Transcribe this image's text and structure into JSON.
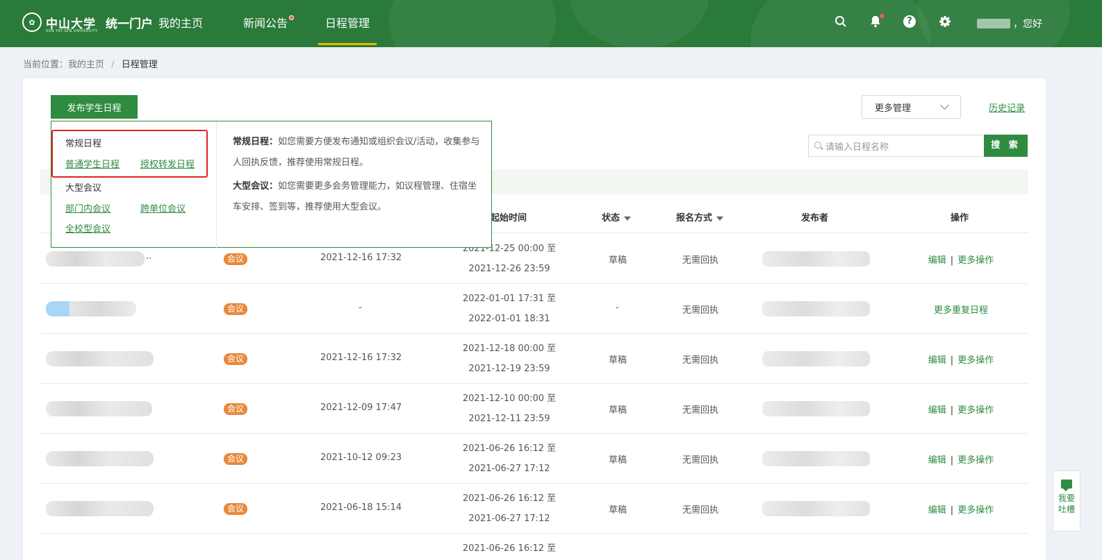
{
  "header": {
    "logo_school": "中山大学",
    "logo_sub": "SUN YAT-SEN UNIVERSITY",
    "portal": "统一门户",
    "nav": [
      {
        "label": "我的主页"
      },
      {
        "label": "新闻公告"
      },
      {
        "label": "日程管理"
      }
    ],
    "greeting": "，您好",
    "colors": {
      "brand": "#2a7a3a",
      "accent": "#f0b400",
      "badge": "#ff5b5b"
    },
    "icons": [
      "search-icon",
      "bell-icon",
      "help-icon",
      "gear-icon"
    ]
  },
  "breadcrumb": {
    "prefix": "当前位置：我的主页",
    "separator": "/",
    "current": "日程管理"
  },
  "toolbar": {
    "publish_label": "发布学生日程",
    "more_manage_label": "更多管理",
    "history_label": "历史记录",
    "search_placeholder": "请输入日程名称",
    "search_button": "搜 索"
  },
  "popup": {
    "group1_title": "常规日程",
    "group1_links": [
      "普通学生日程",
      "授权转发日程"
    ],
    "group2_title": "大型会议",
    "group2_links": [
      "部门内会议",
      "跨单位会议",
      "全校型会议"
    ],
    "desc1_title": "常规日程：",
    "desc1_text": "如您需要方便发布通知或组织会议/活动，收集参与人回执反馈，推荐使用常规日程。",
    "desc2_title": "大型会议：",
    "desc2_text": "如您需要更多会务管理能力，如议程管理、住宿坐车安排、签到等，推荐使用大型会议。"
  },
  "table": {
    "headers": {
      "start_time": "起始时间",
      "status": "状态",
      "signup": "报名方式",
      "publisher": "发布者",
      "actions": "操作"
    },
    "rows": [
      {
        "tag": "会议",
        "created": "2021-12-16 17:32",
        "start": "2021-12-25 00:00 至",
        "end": "2021-12-26 23:59",
        "status": "草稿",
        "signup": "无需回执",
        "op1": "编辑",
        "sep": "|",
        "op2": "更多操作",
        "name_suffix": ".."
      },
      {
        "tag": "会议",
        "created": "-",
        "start": "2022-01-01 17:31 至",
        "end": "2022-01-01 18:31",
        "status": "-",
        "signup": "无需回执",
        "op_single": "更多重复日程"
      },
      {
        "tag": "会议",
        "created": "2021-12-16 17:32",
        "start": "2021-12-18 00:00 至",
        "end": "2021-12-19 23:59",
        "status": "草稿",
        "signup": "无需回执",
        "op1": "编辑",
        "sep": "|",
        "op2": "更多操作"
      },
      {
        "tag": "会议",
        "created": "2021-12-09 17:47",
        "start": "2021-12-10 00:00 至",
        "end": "2021-12-11 23:59",
        "status": "草稿",
        "signup": "无需回执",
        "op1": "编辑",
        "sep": "|",
        "op2": "更多操作"
      },
      {
        "tag": "会议",
        "created": "2021-10-12 09:23",
        "start": "2021-06-26 16:12 至",
        "end": "2021-06-27 17:12",
        "status": "草稿",
        "signup": "无需回执",
        "op1": "编辑",
        "sep": "|",
        "op2": "更多操作"
      },
      {
        "tag": "会议",
        "created": "2021-06-18 15:14",
        "start": "2021-06-26 16:12 至",
        "end": "2021-06-27 17:12",
        "status": "草稿",
        "signup": "无需回执",
        "op1": "编辑",
        "sep": "|",
        "op2": "更多操作"
      },
      {
        "start": "2021-06-26 16:12 至"
      }
    ]
  },
  "feedback": {
    "line1": "我要",
    "line2": "吐槽"
  }
}
